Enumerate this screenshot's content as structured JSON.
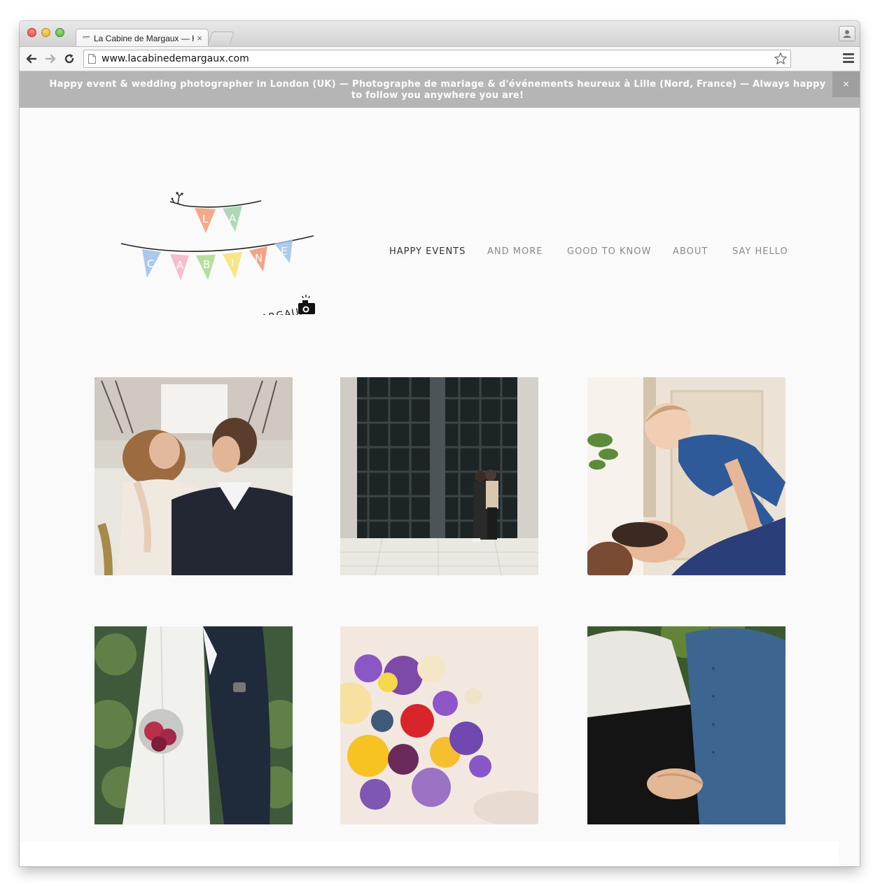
{
  "browser": {
    "tab_title": "La Cabine de Margaux — H",
    "tab_close": "×",
    "url": "www.lacabinedemargaux.com"
  },
  "announcement": {
    "text": "Happy event & wedding photographer in London (UK) — Photographe de mariage & d'événements heureux à Lille (Nord, France) — Always happy to follow you anywhere you are!",
    "close": "×"
  },
  "logo": {
    "flags": [
      "L",
      "A",
      "C",
      "A",
      "B",
      "I",
      "N",
      "E"
    ],
    "subtitle": "DE MARGAUX"
  },
  "nav": {
    "items": [
      {
        "label": "HAPPY EVENTS",
        "active": true
      },
      {
        "label": "AND MORE",
        "active": false
      },
      {
        "label": "GOOD TO KNOW",
        "active": false
      },
      {
        "label": "ABOUT",
        "active": false
      },
      {
        "label": "SAY HELLO",
        "active": false
      }
    ]
  },
  "gallery": {
    "photos": [
      {
        "subject": "couple on stairs"
      },
      {
        "subject": "couple kissing by door"
      },
      {
        "subject": "parents lifting baby"
      },
      {
        "subject": "bride with bouquet and groom"
      },
      {
        "subject": "flower bouquet"
      },
      {
        "subject": "pregnant couple"
      }
    ]
  },
  "colors": {
    "announce_bg": "#b5b5b5",
    "nav_active": "#333333",
    "nav_inactive": "#8a8a8a",
    "page_bg": "#fafafa"
  },
  "icons": [
    "back-arrow-icon",
    "forward-arrow-icon",
    "reload-icon",
    "page-icon",
    "star-icon",
    "menu-icon",
    "profile-icon",
    "close-icon",
    "camera-icon"
  ]
}
